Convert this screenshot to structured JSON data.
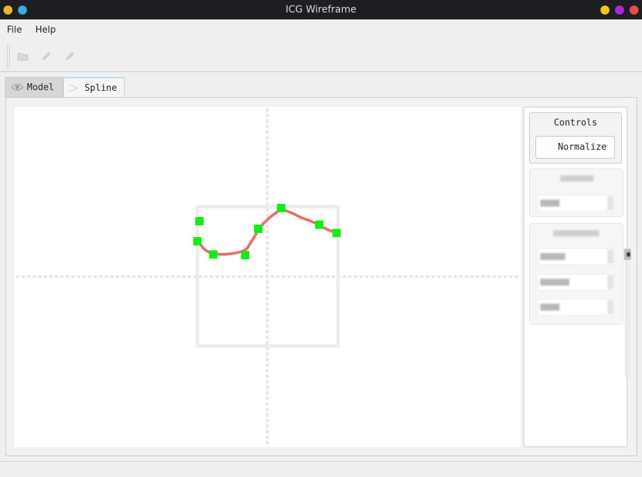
{
  "window": {
    "title": "ICG Wireframe",
    "left_controls": [
      {
        "name": "app-icon",
        "color": "#f0b429"
      },
      {
        "name": "pin-icon",
        "color": "#3ea8e6"
      }
    ],
    "right_controls": [
      {
        "name": "minimize-button",
        "color": "#f5c518"
      },
      {
        "name": "maximize-button",
        "color": "#b324d6"
      },
      {
        "name": "close-button",
        "color": "#f0474a"
      }
    ]
  },
  "menu": {
    "file": "File",
    "help": "Help"
  },
  "toolbar": {
    "icons": [
      "open-folder-icon",
      "pencil-icon",
      "pencil-icon"
    ]
  },
  "tabs": {
    "model": {
      "label": "Model",
      "icon": "eye-icon"
    },
    "spline": {
      "label": "Spline",
      "icon": "spline-icon",
      "active": true
    }
  },
  "controls": {
    "title": "Controls",
    "normalize_label": "Normalize"
  },
  "colors": {
    "spline": "#e8706c",
    "control_point": "#11ee11",
    "axis": "#e6e6e6",
    "bounds": "#e8e8e8"
  }
}
